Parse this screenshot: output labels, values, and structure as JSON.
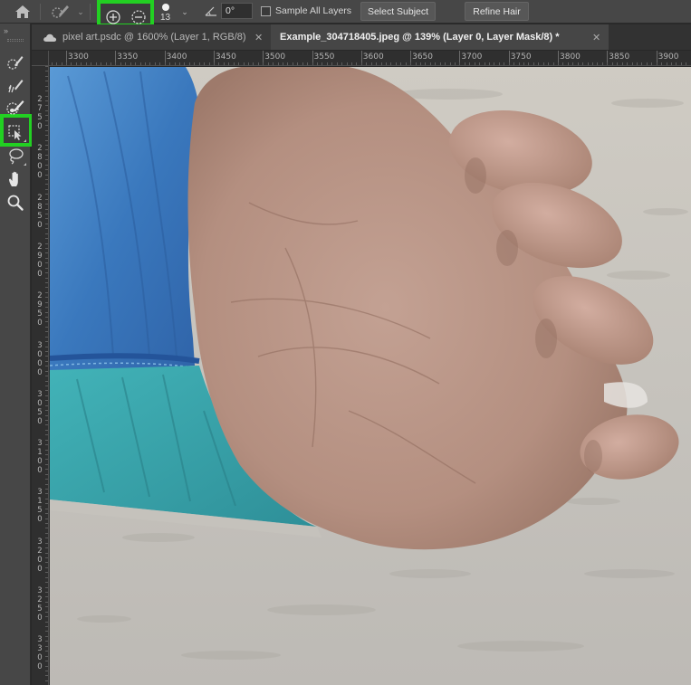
{
  "options_bar": {
    "brush_size": "13",
    "angle_value": "0°",
    "sample_all_layers_label": "Sample All Layers",
    "sample_all_layers_checked": false,
    "select_subject_label": "Select Subject",
    "refine_hair_label": "Refine Hair",
    "highlight_color": "#22d022"
  },
  "tabs": [
    {
      "label": "pixel art.psdc @ 1600% (Layer 1, RGB/8)",
      "active": false
    },
    {
      "label": "Example_304718405.jpeg @ 139% (Layer 0, Layer Mask/8) *",
      "active": true
    }
  ],
  "rulers": {
    "top": [
      "3300",
      "3350",
      "3400",
      "3450",
      "3500",
      "3550",
      "3600",
      "3650",
      "3700",
      "3750",
      "3800",
      "3850",
      "3900"
    ],
    "left": [
      "2750",
      "2800",
      "2850",
      "2900",
      "2950",
      "3000",
      "3050",
      "3100",
      "3150",
      "3200",
      "3250",
      "3300"
    ]
  },
  "toolbar": {
    "tools": [
      {
        "name": "quick-selection-tool",
        "icon": "brush-selection-icon"
      },
      {
        "name": "refine-edge-brush-tool",
        "icon": "refine-brush-icon"
      },
      {
        "name": "brush-tool",
        "icon": "brush-icon",
        "active": true
      },
      {
        "name": "object-selection-tool",
        "icon": "object-select-icon"
      },
      {
        "name": "lasso-tool",
        "icon": "lasso-icon"
      },
      {
        "name": "hand-tool",
        "icon": "hand-icon"
      },
      {
        "name": "zoom-tool",
        "icon": "zoom-icon"
      }
    ]
  },
  "canvas": {
    "subject": "hand",
    "colors": {
      "background": "#c8c4bc",
      "skin": "#b89484",
      "sleeve_blue": "#3e7fc2",
      "cuff_teal": "#3aa4aa"
    }
  }
}
